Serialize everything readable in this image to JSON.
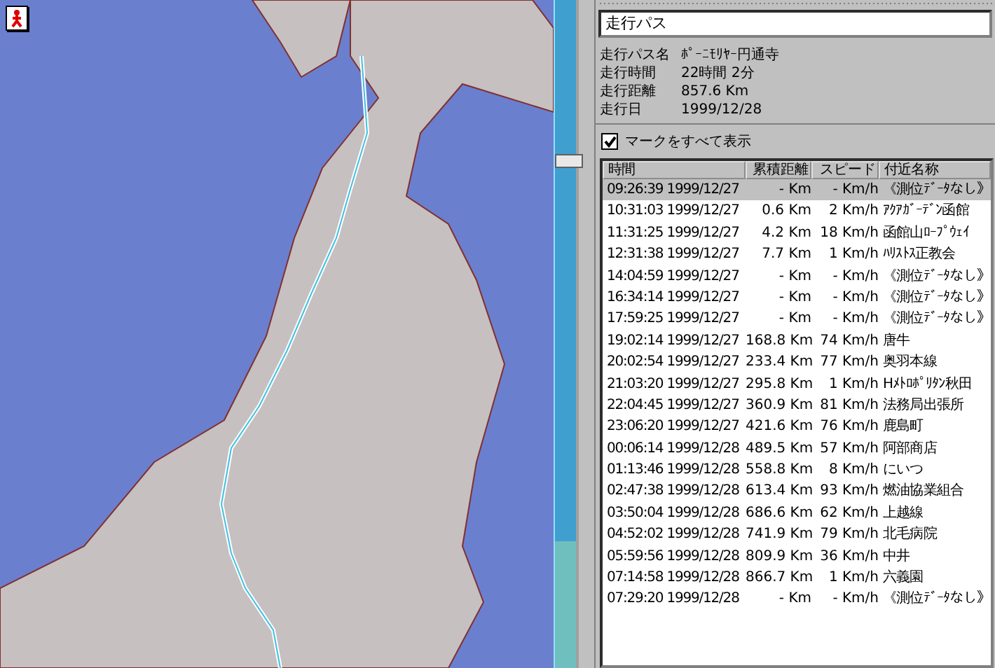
{
  "map": {
    "zoom_slider": {
      "level": 0.76
    }
  },
  "path_field": {
    "value": "走行パス"
  },
  "info": [
    {
      "label": "走行パス名",
      "value": "ﾎﾟｰﾆﾓﾘﾔｰ円通寺"
    },
    {
      "label": "走行時間",
      "value": "22時間 2分"
    },
    {
      "label": "走行距離",
      "value": "857.6 Km"
    },
    {
      "label": "走行日",
      "value": "1999/12/28"
    }
  ],
  "show_all_marks": {
    "label": "マークをすべて表示",
    "checked": true
  },
  "table": {
    "columns": [
      "時間",
      "累積距離",
      "スピード",
      "付近名称"
    ],
    "rows": [
      {
        "time": "09:26:39 1999/12/27",
        "distance": "- Km",
        "speed": "- Km/h",
        "place": "《測位ﾃﾞｰﾀなし》",
        "selected": true
      },
      {
        "time": "10:31:03 1999/12/27",
        "distance": "0.6 Km",
        "speed": "2 Km/h",
        "place": "ｱｸｱｶﾞｰﾃﾞﾝ函館",
        "selected": false
      },
      {
        "time": "11:31:25 1999/12/27",
        "distance": "4.2 Km",
        "speed": "18 Km/h",
        "place": "函館山ﾛｰﾌﾟｳｪｲ",
        "selected": false
      },
      {
        "time": "12:31:38 1999/12/27",
        "distance": "7.7 Km",
        "speed": "1 Km/h",
        "place": "ﾊﾘｽﾄｽ正教会",
        "selected": false
      },
      {
        "time": "14:04:59 1999/12/27",
        "distance": "- Km",
        "speed": "- Km/h",
        "place": "《測位ﾃﾞｰﾀなし》",
        "selected": false
      },
      {
        "time": "16:34:14 1999/12/27",
        "distance": "- Km",
        "speed": "- Km/h",
        "place": "《測位ﾃﾞｰﾀなし》",
        "selected": false
      },
      {
        "time": "17:59:25 1999/12/27",
        "distance": "- Km",
        "speed": "- Km/h",
        "place": "《測位ﾃﾞｰﾀなし》",
        "selected": false
      },
      {
        "time": "19:02:14 1999/12/27",
        "distance": "168.8 Km",
        "speed": "74 Km/h",
        "place": "唐牛",
        "selected": false
      },
      {
        "time": "20:02:54 1999/12/27",
        "distance": "233.4 Km",
        "speed": "77 Km/h",
        "place": "奥羽本線",
        "selected": false
      },
      {
        "time": "21:03:20 1999/12/27",
        "distance": "295.8 Km",
        "speed": "1 Km/h",
        "place": "Hﾒﾄﾛﾎﾟﾘﾀﾝ秋田",
        "selected": false
      },
      {
        "time": "22:04:45 1999/12/27",
        "distance": "360.9 Km",
        "speed": "81 Km/h",
        "place": "法務局出張所",
        "selected": false
      },
      {
        "time": "23:06:20 1999/12/27",
        "distance": "421.6 Km",
        "speed": "76 Km/h",
        "place": "鹿島町",
        "selected": false
      },
      {
        "time": "00:06:14 1999/12/28",
        "distance": "489.5 Km",
        "speed": "57 Km/h",
        "place": "阿部商店",
        "selected": false
      },
      {
        "time": "01:13:46 1999/12/28",
        "distance": "558.8 Km",
        "speed": "8 Km/h",
        "place": "にいつ",
        "selected": false
      },
      {
        "time": "02:47:38 1999/12/28",
        "distance": "613.4 Km",
        "speed": "93 Km/h",
        "place": "燃油協業組合",
        "selected": false
      },
      {
        "time": "03:50:04 1999/12/28",
        "distance": "686.6 Km",
        "speed": "62 Km/h",
        "place": "上越線",
        "selected": false
      },
      {
        "time": "04:52:02 1999/12/28",
        "distance": "741.9 Km",
        "speed": "79 Km/h",
        "place": "北毛病院",
        "selected": false
      },
      {
        "time": "05:59:56 1999/12/28",
        "distance": "809.9 Km",
        "speed": "36 Km/h",
        "place": "中井",
        "selected": false
      },
      {
        "time": "07:14:58 1999/12/28",
        "distance": "866.7 Km",
        "speed": "1 Km/h",
        "place": "六義園",
        "selected": false
      },
      {
        "time": "07:29:20 1999/12/28",
        "distance": "- Km",
        "speed": "- Km/h",
        "place": "《測位ﾃﾞｰﾀなし》",
        "selected": false
      }
    ]
  }
}
